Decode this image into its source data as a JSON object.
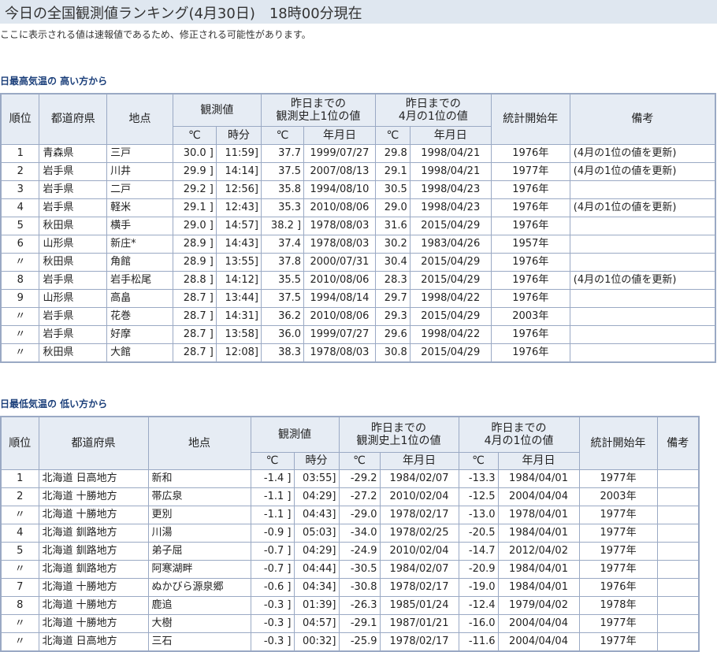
{
  "page": {
    "title": "今日の全国観測値ランキング(4月30日)　18時00分現在",
    "notice": "ここに表示される値は速報値であるため、修正される可能性があります。"
  },
  "high": {
    "section_title": "日最高気温の 高い方から",
    "headers": {
      "rank": "順位",
      "pref": "都道府県",
      "place": "地点",
      "obs": "観測値",
      "hist": "昨日までの\n観測史上1位の値",
      "month": "昨日までの\n4月の1位の値",
      "start": "統計開始年",
      "note": "備考",
      "temp": "℃",
      "time": "時分",
      "date": "年月日"
    },
    "rows": [
      {
        "rank": "1",
        "pref": "青森県",
        "place": "三戸",
        "temp": "30.0 ]",
        "time": "11:59]",
        "hist_temp": "37.7",
        "hist_date": "1999/07/27",
        "mon_temp": "29.8",
        "mon_date": "1998/04/21",
        "start": "1976年",
        "note": "(4月の1位の値を更新)"
      },
      {
        "rank": "2",
        "pref": "岩手県",
        "place": "川井",
        "temp": "29.9 ]",
        "time": "14:14]",
        "hist_temp": "37.5",
        "hist_date": "2007/08/13",
        "mon_temp": "29.1",
        "mon_date": "1998/04/21",
        "start": "1977年",
        "note": "(4月の1位の値を更新)"
      },
      {
        "rank": "3",
        "pref": "岩手県",
        "place": "二戸",
        "temp": "29.2 ]",
        "time": "12:56]",
        "hist_temp": "35.8",
        "hist_date": "1994/08/10",
        "mon_temp": "30.5",
        "mon_date": "1998/04/23",
        "start": "1976年",
        "note": ""
      },
      {
        "rank": "4",
        "pref": "岩手県",
        "place": "軽米",
        "temp": "29.1 ]",
        "time": "12:43]",
        "hist_temp": "35.3",
        "hist_date": "2010/08/06",
        "mon_temp": "29.0",
        "mon_date": "1998/04/23",
        "start": "1976年",
        "note": "(4月の1位の値を更新)"
      },
      {
        "rank": "5",
        "pref": "秋田県",
        "place": "横手",
        "temp": "29.0 ]",
        "time": "14:57]",
        "hist_temp": "38.2 ]",
        "hist_date": "1978/08/03",
        "mon_temp": "31.6",
        "mon_date": "2015/04/29",
        "start": "1976年",
        "note": ""
      },
      {
        "rank": "6",
        "pref": "山形県",
        "place": "新庄*",
        "temp": "28.9 ]",
        "time": "14:43]",
        "hist_temp": "37.4",
        "hist_date": "1978/08/03",
        "mon_temp": "30.2",
        "mon_date": "1983/04/26",
        "start": "1957年",
        "note": ""
      },
      {
        "rank": "〃",
        "pref": "秋田県",
        "place": "角館",
        "temp": "28.9 ]",
        "time": "13:55]",
        "hist_temp": "37.8",
        "hist_date": "2000/07/31",
        "mon_temp": "30.4",
        "mon_date": "2015/04/29",
        "start": "1976年",
        "note": ""
      },
      {
        "rank": "8",
        "pref": "岩手県",
        "place": "岩手松尾",
        "temp": "28.8 ]",
        "time": "14:12]",
        "hist_temp": "35.5",
        "hist_date": "2010/08/06",
        "mon_temp": "28.3",
        "mon_date": "2015/04/29",
        "start": "1976年",
        "note": "(4月の1位の値を更新)"
      },
      {
        "rank": "9",
        "pref": "山形県",
        "place": "高畠",
        "temp": "28.7 ]",
        "time": "13:44]",
        "hist_temp": "37.5",
        "hist_date": "1994/08/14",
        "mon_temp": "29.7",
        "mon_date": "1998/04/22",
        "start": "1976年",
        "note": ""
      },
      {
        "rank": "〃",
        "pref": "岩手県",
        "place": "花巻",
        "temp": "28.7 ]",
        "time": "14:31]",
        "hist_temp": "36.2",
        "hist_date": "2010/08/06",
        "mon_temp": "29.3",
        "mon_date": "2015/04/29",
        "start": "2003年",
        "note": ""
      },
      {
        "rank": "〃",
        "pref": "岩手県",
        "place": "好摩",
        "temp": "28.7 ]",
        "time": "13:58]",
        "hist_temp": "36.0",
        "hist_date": "1999/07/27",
        "mon_temp": "29.6",
        "mon_date": "1998/04/22",
        "start": "1976年",
        "note": ""
      },
      {
        "rank": "〃",
        "pref": "秋田県",
        "place": "大館",
        "temp": "28.7 ]",
        "time": "12:08]",
        "hist_temp": "38.3",
        "hist_date": "1978/08/03",
        "mon_temp": "30.8",
        "mon_date": "2015/04/29",
        "start": "1976年",
        "note": ""
      }
    ]
  },
  "low": {
    "section_title": "日最低気温の 低い方から",
    "headers": {
      "rank": "順位",
      "pref": "都道府県",
      "place": "地点",
      "obs": "観測値",
      "hist": "昨日までの\n観測史上1位の値",
      "month": "昨日までの\n4月の1位の値",
      "start": "統計開始年",
      "note": "備考",
      "temp": "℃",
      "time": "時分",
      "date": "年月日"
    },
    "rows": [
      {
        "rank": "1",
        "pref": "北海道 日高地方",
        "place": "新和",
        "temp": "-1.4 ]",
        "time": "03:55]",
        "hist_temp": "-29.2",
        "hist_date": "1984/02/07",
        "mon_temp": "-13.3",
        "mon_date": "1984/04/01",
        "start": "1977年",
        "note": ""
      },
      {
        "rank": "2",
        "pref": "北海道 十勝地方",
        "place": "帯広泉",
        "temp": "-1.1 ]",
        "time": "04:29]",
        "hist_temp": "-27.2",
        "hist_date": "2010/02/04",
        "mon_temp": "-12.5",
        "mon_date": "2004/04/04",
        "start": "2003年",
        "note": ""
      },
      {
        "rank": "〃",
        "pref": "北海道 十勝地方",
        "place": "更別",
        "temp": "-1.1 ]",
        "time": "04:43]",
        "hist_temp": "-29.0",
        "hist_date": "1978/02/17",
        "mon_temp": "-13.0",
        "mon_date": "1978/04/01",
        "start": "1977年",
        "note": ""
      },
      {
        "rank": "4",
        "pref": "北海道 釧路地方",
        "place": "川湯",
        "temp": "-0.9 ]",
        "time": "05:03]",
        "hist_temp": "-34.0",
        "hist_date": "1978/02/25",
        "mon_temp": "-20.5",
        "mon_date": "1984/04/01",
        "start": "1977年",
        "note": ""
      },
      {
        "rank": "5",
        "pref": "北海道 釧路地方",
        "place": "弟子屈",
        "temp": "-0.7 ]",
        "time": "04:29]",
        "hist_temp": "-24.9",
        "hist_date": "2010/02/04",
        "mon_temp": "-14.7",
        "mon_date": "2012/04/02",
        "start": "1977年",
        "note": ""
      },
      {
        "rank": "〃",
        "pref": "北海道 釧路地方",
        "place": "阿寒湖畔",
        "temp": "-0.7 ]",
        "time": "04:44]",
        "hist_temp": "-30.5",
        "hist_date": "1984/02/07",
        "mon_temp": "-20.9",
        "mon_date": "1984/04/01",
        "start": "1977年",
        "note": ""
      },
      {
        "rank": "7",
        "pref": "北海道 十勝地方",
        "place": "ぬかびら源泉郷",
        "temp": "-0.6 ]",
        "time": "04:34]",
        "hist_temp": "-30.8",
        "hist_date": "1978/02/17",
        "mon_temp": "-19.0",
        "mon_date": "1984/04/01",
        "start": "1976年",
        "note": ""
      },
      {
        "rank": "8",
        "pref": "北海道 十勝地方",
        "place": "鹿追",
        "temp": "-0.3 ]",
        "time": "01:39]",
        "hist_temp": "-26.3",
        "hist_date": "1985/01/24",
        "mon_temp": "-12.4",
        "mon_date": "1979/04/02",
        "start": "1978年",
        "note": ""
      },
      {
        "rank": "〃",
        "pref": "北海道 十勝地方",
        "place": "大樹",
        "temp": "-0.3 ]",
        "time": "04:57]",
        "hist_temp": "-29.1",
        "hist_date": "1987/01/21",
        "mon_temp": "-16.0",
        "mon_date": "2004/04/04",
        "start": "1977年",
        "note": ""
      },
      {
        "rank": "〃",
        "pref": "北海道 日高地方",
        "place": "三石",
        "temp": "-0.3 ]",
        "time": "00:32]",
        "hist_temp": "-25.9",
        "hist_date": "1978/02/17",
        "mon_temp": "-11.6",
        "mon_date": "2004/04/04",
        "start": "1977年",
        "note": ""
      }
    ]
  }
}
